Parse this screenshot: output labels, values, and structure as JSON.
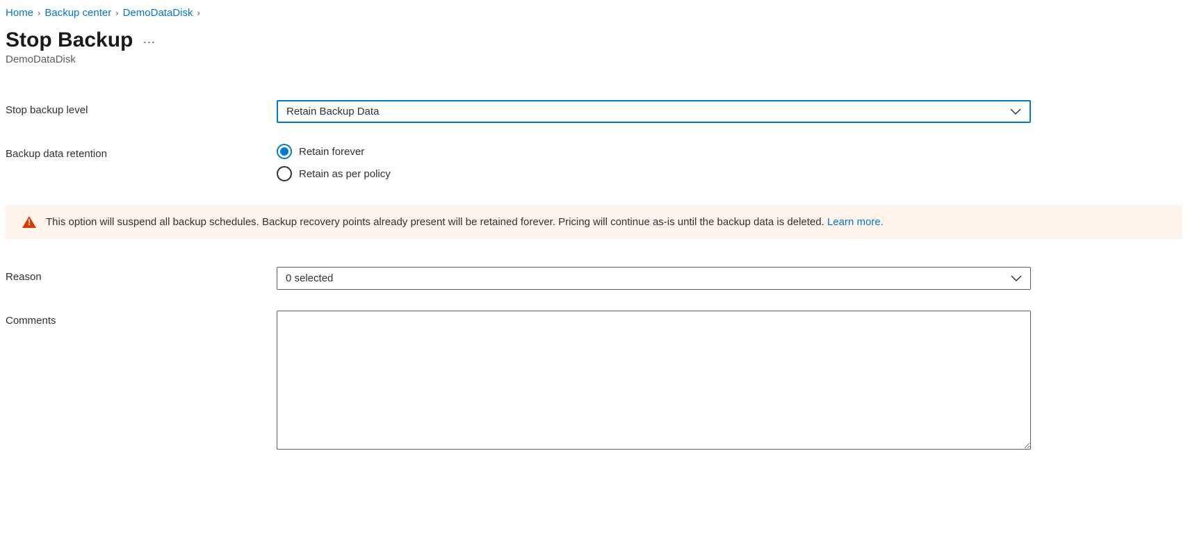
{
  "breadcrumb": {
    "items": [
      "Home",
      "Backup center",
      "DemoDataDisk"
    ]
  },
  "page": {
    "title": "Stop Backup",
    "subtitle": "DemoDataDisk"
  },
  "form": {
    "stop_backup_level": {
      "label": "Stop backup level",
      "value": "Retain Backup Data"
    },
    "retention": {
      "label": "Backup data retention",
      "options": [
        "Retain forever",
        "Retain as per policy"
      ],
      "selected_index": 0
    },
    "warning": {
      "text": "This option will suspend all backup schedules. Backup recovery points already present will be retained forever. Pricing will continue as-is until the backup data is deleted. ",
      "link": "Learn more."
    },
    "reason": {
      "label": "Reason",
      "value": "0 selected"
    },
    "comments": {
      "label": "Comments",
      "value": ""
    }
  }
}
